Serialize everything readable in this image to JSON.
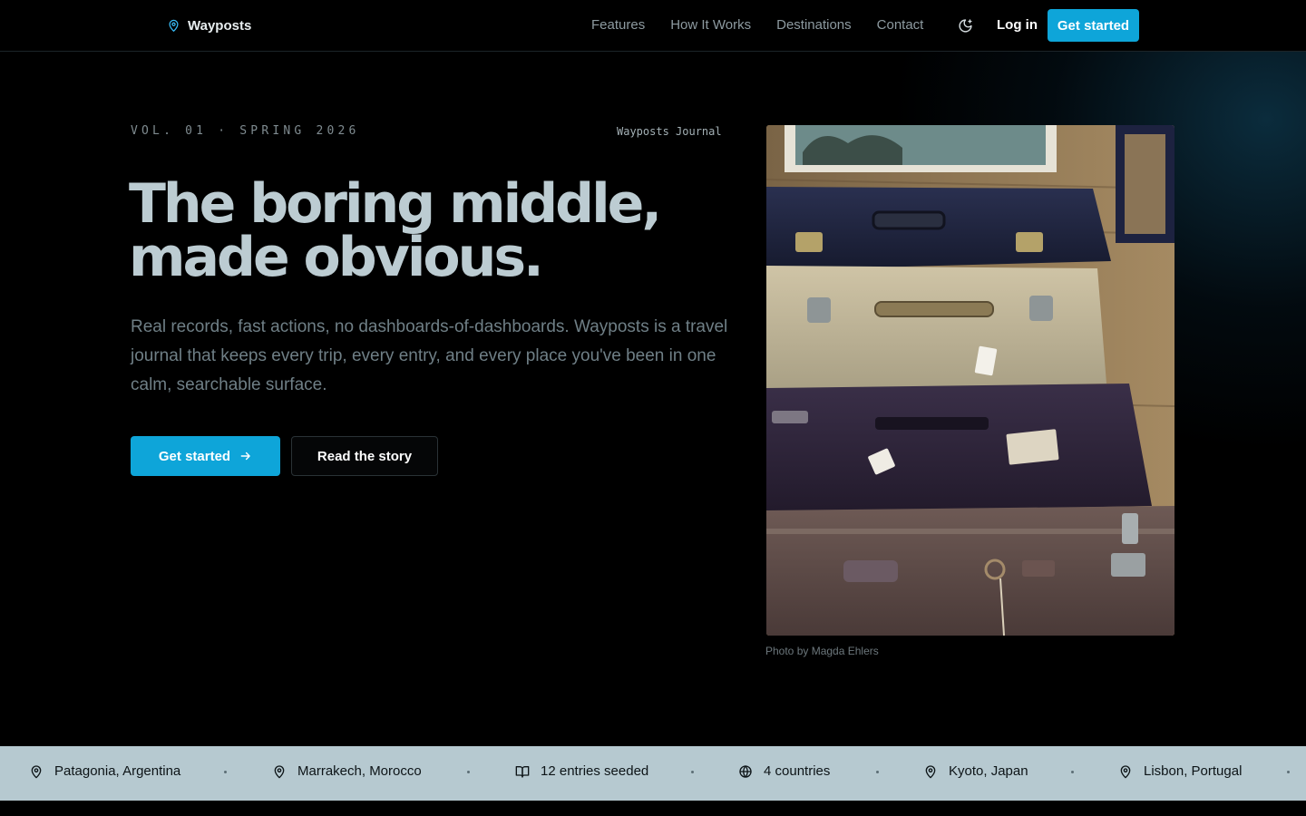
{
  "nav": {
    "brand": "Wayposts",
    "links": [
      "Features",
      "How It Works",
      "Destinations",
      "Contact"
    ],
    "login": "Log in",
    "cta": "Get started"
  },
  "hero": {
    "eyebrow": "VOL. 01 · SPRING 2026",
    "journal_tag": "Wayposts Journal",
    "headline_line1": "The boring middle,",
    "headline_line2": "made obvious.",
    "lead": "Real records, fast actions, no dashboards-of-dashboards. Wayposts is a travel journal that keeps every trip, every entry, and every place you've been in one calm, searchable surface.",
    "primary_cta": "Get started",
    "secondary_cta": "Read the story",
    "photo_caption": "Photo by Magda Ehlers"
  },
  "ticker": {
    "items": [
      {
        "icon": "map-pin-icon",
        "label": "Patagonia, Argentina"
      },
      {
        "icon": "map-pin-icon",
        "label": "Marrakech, Morocco"
      },
      {
        "icon": "book-open-icon",
        "label": "12 entries seeded"
      },
      {
        "icon": "globe-icon",
        "label": "4 countries"
      },
      {
        "icon": "map-pin-icon",
        "label": "Kyoto, Japan"
      },
      {
        "icon": "map-pin-icon",
        "label": "Lisbon, Portugal"
      }
    ]
  },
  "colors": {
    "accent": "#0ea5d9",
    "headline": "#bcccd2",
    "ticker_bg": "#b6c9d0",
    "background": "#000000"
  }
}
